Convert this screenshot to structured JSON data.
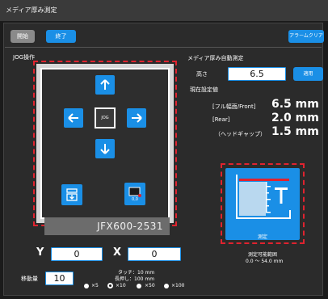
{
  "window": {
    "title": "メディア厚み測定"
  },
  "toolbar": {
    "start_label": "開始",
    "end_label": "終了",
    "alarm_clear_label": "アラームクリア"
  },
  "jog": {
    "section_title": "JOG操作",
    "center_label": "JOG",
    "origin_label": "0,0",
    "model_name": "JFX600-2531",
    "x_label": "X",
    "y_label": "Y",
    "x_value": "0",
    "y_value": "0",
    "move_amount_label": "移動量",
    "move_amount_value": "10",
    "touch_info": "タッチ：10 mm",
    "long_press_info": "長押し：100 mm",
    "multipliers": [
      "×5",
      "×10",
      "×50",
      "×100"
    ],
    "selected_multiplier": "×10"
  },
  "auto_measure": {
    "section_title": "メディア厚み自動測定",
    "height_label": "高さ",
    "height_value": "6.5",
    "apply_label": "適用",
    "current_settings_label": "現在設定値",
    "rows": [
      {
        "label": "[フル幅面/Front]",
        "value": "6.5 mm"
      },
      {
        "label": "[Rear]",
        "value": "2.0 mm"
      },
      {
        "label": "（ヘッドギャップ）",
        "value": "1.5 mm"
      }
    ],
    "measure_button_label": "測定",
    "range_label": "測定可能範囲",
    "range_value": "0.0 〜 54.0 mm"
  },
  "colors": {
    "accent": "#1a8fe6",
    "highlight": "#e0232f"
  }
}
